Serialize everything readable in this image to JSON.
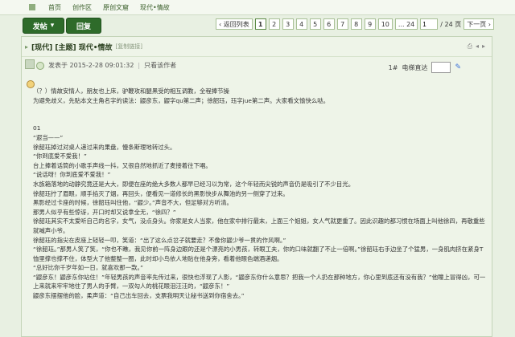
{
  "nav": {
    "items": [
      "首页",
      "创作区",
      "原创文窟",
      "现代•情故"
    ]
  },
  "toolbar": {
    "post_label": "发帖",
    "post_arrow": "▾",
    "reply_label": "回复",
    "pager": {
      "prev": "‹ 返回列表",
      "pages": [
        "1",
        "2",
        "3",
        "4",
        "5",
        "6",
        "7",
        "8",
        "9",
        "10"
      ],
      "ellipsis": "...",
      "last": "24",
      "input_value": "1",
      "total": "/ 24 页",
      "next": "下一页 ›"
    }
  },
  "thread": {
    "title": "[现代] [主题] 现代•情故",
    "copy_link": "[复制链接]",
    "icons": [
      "print-icon",
      "prev-thread-icon",
      "next-thread-icon"
    ]
  },
  "post": {
    "posted_at": "发表于 2015-2-28 09:01:32",
    "only_author": "只看该作者",
    "floor": "1#",
    "jump_label": "电梯直达",
    "jump_value": ""
  },
  "content": {
    "lines": [
      "（？）情故安情人，朋友也上床，驴鞭攻和腿黑受的相互调教，全程捧节操",
      "为避免歧义，先贴本文主角名字的读法：鼹彦东，鼹字qu第二声；徐韶珏，珏字jue第二声。大家看文愉快么哒。",
      "",
      "",
      "01",
      "“遐当——”",
      "徐韶珏掉过对桌人递过来的果盘，慢条斯理地转过头。",
      "“你到底爱不爱我！”",
      "台上捧着话筒的小歌手声线一抖，又很自然地抓近了麦接着往下唱。",
      "“说话呀！你到底爱不爱我！”",
      "水族箱落地的动静究竟还是大大，即便在座的绝大多数人都早已经习以为常，这个年轻而尖锐的声音仍是吸引了不少目光。",
      "徐韶珏拧了眉眼，顺手掐灭了烟，再回头，便看见一道修长的黑影快步从舞池的另一侧穿了过来。",
      "黑影经过卡座的时候，徐韶珏叫住他，“鼹少。”声音不大，但足够对方听清。",
      "那男人似乎有些惊讶，开口时却又说拿全无，“徐四？”",
      "徐韶珏其实不太爱听自己的名字，女气，没点身头。你家是女人当家，他在家中排行最末，上面三个姐姐，女人气就更重了。因此识趣的都习惯在场面上叫他徐四，再敬重些就喊声小爷。",
      "徐韶珏的指尖在皮座上轻轻一叩，笑道：“出了这么点岔子就要走？不像你鼹少爷一贯的作风啊。”",
      "“徐韶珏。”那男人笑了笑，“你也不瞧，我见你前一阵身边跟的还是个漂亮的小男孩，转眼工夫，你的口味就翻了不止一倍啊。”徐韶珏右手边坐了个猛男，一身肌肉挤在紧身T恤里撑也撑不住，体型大了他整整一圈，此时却小鸟依人地贴在他身旁，看着他眼色端酒递烟。",
      "“总好比你千岁年如一日，就喜欢那一款。”",
      "“鼹彦东！鼹彦东你站住！”年轻男孩的声音率先传过来，很快也浮现了人影，“鼹彦东你什么意思？把我一个人扔在那种地方，你心里到底还有没有我？”他瞳上冒得凶，可一上来就来牢牢地住了男人的手臂，一双勾人的桃花眼泪汪汪的，“鼹彦东！”",
      "鼹彦东摆摆他的脸，柔声道：“自己出车回去，支票我明天让秘书送到你宿舍去。”"
    ]
  }
}
